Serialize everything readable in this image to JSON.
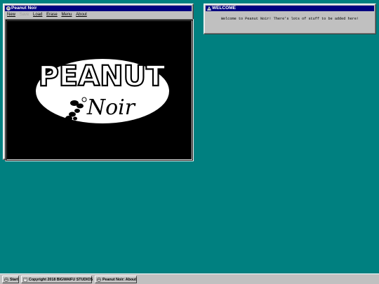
{
  "main_window": {
    "title": "Peanut Noir",
    "menu": [
      {
        "label": "New",
        "enabled": true
      },
      {
        "label": "Save",
        "enabled": false
      },
      {
        "label": "Load",
        "enabled": true
      },
      {
        "label": "Erase",
        "enabled": true
      },
      {
        "label": "Menu",
        "enabled": true
      },
      {
        "label": "About",
        "enabled": true
      }
    ],
    "logo_text_top": "PEANUT",
    "logo_text_bottom": "Noir"
  },
  "welcome_window": {
    "title": "WELCOME",
    "message": "Welcome to Peanut Noir! There's lots of stuff to be added here!"
  },
  "taskbar": {
    "start_label": "Start",
    "copyright_label": "Copyright 2018 BIGWAIFU STUDIOS",
    "task_label": "Peanut Noir: About"
  },
  "colors": {
    "desktop": "#008080",
    "titlebar": "#000080",
    "window": "#c0c0c0"
  }
}
